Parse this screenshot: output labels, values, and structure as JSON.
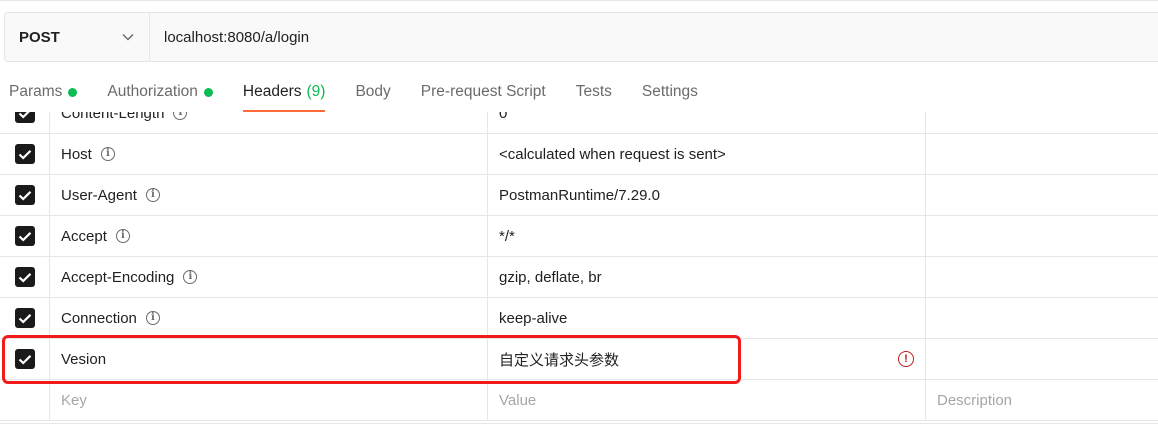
{
  "request": {
    "method": "POST",
    "url": "localhost:8080/a/login"
  },
  "tabs": [
    {
      "label": "Params",
      "dot": true
    },
    {
      "label": "Authorization",
      "dot": true
    },
    {
      "label": "Headers",
      "count": "(9)",
      "active": true
    },
    {
      "label": "Body"
    },
    {
      "label": "Pre-request Script"
    },
    {
      "label": "Tests"
    },
    {
      "label": "Settings"
    }
  ],
  "headers": [
    {
      "key": "Content-Length",
      "value": "0",
      "checked": true
    },
    {
      "key": "Host",
      "value": "<calculated when request is sent>",
      "checked": true
    },
    {
      "key": "User-Agent",
      "value": "PostmanRuntime/7.29.0",
      "checked": true
    },
    {
      "key": "Accept",
      "value": "*/*",
      "checked": true
    },
    {
      "key": "Accept-Encoding",
      "value": "gzip, deflate, br",
      "checked": true
    },
    {
      "key": "Connection",
      "value": "keep-alive",
      "checked": true
    },
    {
      "key": "Vesion",
      "value": "自定义请求头参数",
      "checked": true,
      "warning": true
    }
  ],
  "new_row": {
    "key_placeholder": "Key",
    "value_placeholder": "Value",
    "description_placeholder": "Description"
  },
  "colors": {
    "accent": "#ff6c37",
    "status_dot": "#0cbb52",
    "highlight_box": "#f11b1b",
    "warning": "#c11a1a"
  }
}
